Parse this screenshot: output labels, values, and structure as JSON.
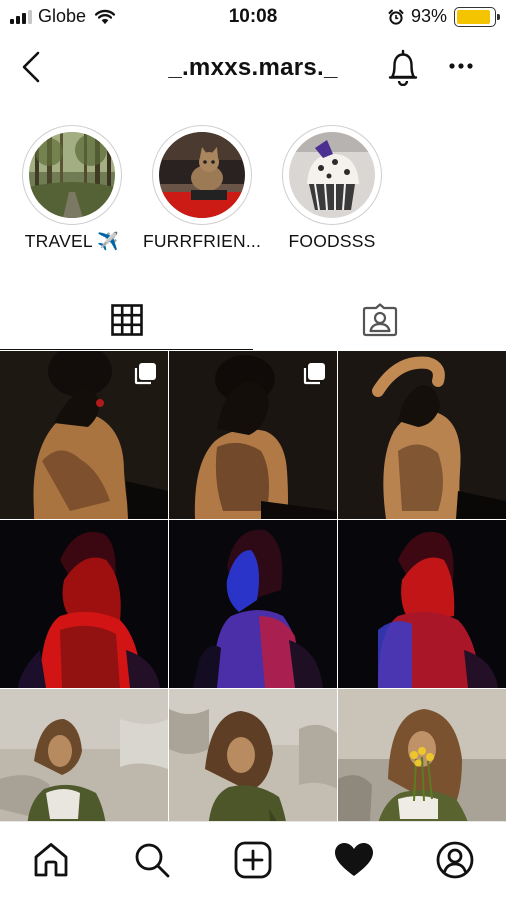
{
  "status_bar": {
    "carrier": "Globe",
    "time": "10:08",
    "battery_percent": "93%",
    "battery_level": 0.93,
    "battery_color": "#f5c400",
    "signal_icon": "signal-bars-icon",
    "wifi_icon": "wifi-icon",
    "alarm_icon": "alarm-clock-icon"
  },
  "header": {
    "username": "_.mxxs.mars._",
    "back_icon": "chevron-left-icon",
    "bell_icon": "bell-icon",
    "more_icon": "ellipsis-icon"
  },
  "highlights": [
    {
      "label": "TRAVEL ✈️",
      "cover": "forest-road"
    },
    {
      "label": "FURRFRIEN...",
      "cover": "tabby-cat"
    },
    {
      "label": "FOODSSS",
      "cover": "cupcake"
    }
  ],
  "tabs": [
    {
      "name": "posts-grid",
      "icon": "grid-icon",
      "active": true
    },
    {
      "name": "tagged",
      "icon": "tagged-person-icon",
      "active": false
    }
  ],
  "grid": [
    {
      "scene": "warm-back-tattoo-1",
      "multi": true
    },
    {
      "scene": "warm-back-tattoo-2",
      "multi": true
    },
    {
      "scene": "warm-back-tattoo-3",
      "multi": false
    },
    {
      "scene": "red-blue-light-1",
      "multi": false
    },
    {
      "scene": "red-blue-light-2",
      "multi": false
    },
    {
      "scene": "red-blue-light-3",
      "multi": false
    },
    {
      "scene": "concrete-wall-flowers-1",
      "multi": false
    },
    {
      "scene": "concrete-wall-flowers-2",
      "multi": false
    },
    {
      "scene": "concrete-wall-flowers-3",
      "multi": false
    }
  ],
  "bottom_nav": [
    {
      "name": "home",
      "icon": "home-icon"
    },
    {
      "name": "search",
      "icon": "search-icon"
    },
    {
      "name": "new-post",
      "icon": "plus-square-icon"
    },
    {
      "name": "activity",
      "icon": "heart-icon"
    },
    {
      "name": "profile",
      "icon": "profile-icon"
    }
  ]
}
